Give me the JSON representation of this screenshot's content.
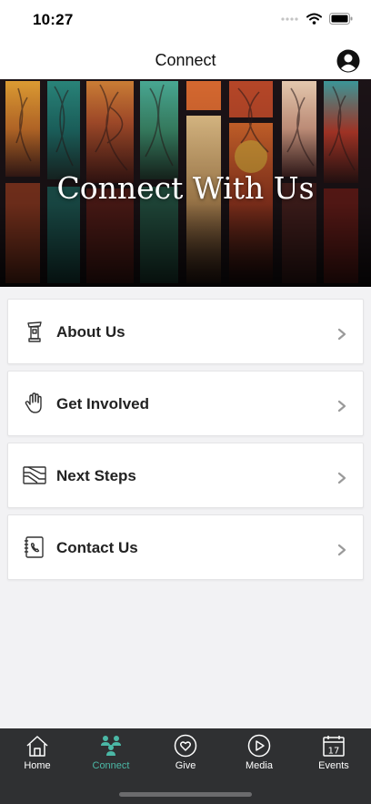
{
  "status_bar": {
    "time": "10:27"
  },
  "nav": {
    "title": "Connect"
  },
  "hero": {
    "title": "Connect With Us"
  },
  "menu": {
    "items": [
      {
        "label": "About Us",
        "icon": "pulpit-icon"
      },
      {
        "label": "Get Involved",
        "icon": "raised-hand-icon"
      },
      {
        "label": "Next Steps",
        "icon": "steps-icon"
      },
      {
        "label": "Contact Us",
        "icon": "contact-book-icon"
      }
    ]
  },
  "tab_bar": {
    "tabs": [
      {
        "label": "Home",
        "icon": "home-icon"
      },
      {
        "label": "Connect",
        "icon": "people-icon",
        "active": true
      },
      {
        "label": "Give",
        "icon": "heart-icon"
      },
      {
        "label": "Media",
        "icon": "play-icon"
      },
      {
        "label": "Events",
        "icon": "calendar-icon",
        "badge": "17"
      }
    ]
  },
  "colors": {
    "accent": "#4bb8a6",
    "tab_bar_bg": "#2f3032",
    "page_bg": "#f2f2f4"
  }
}
